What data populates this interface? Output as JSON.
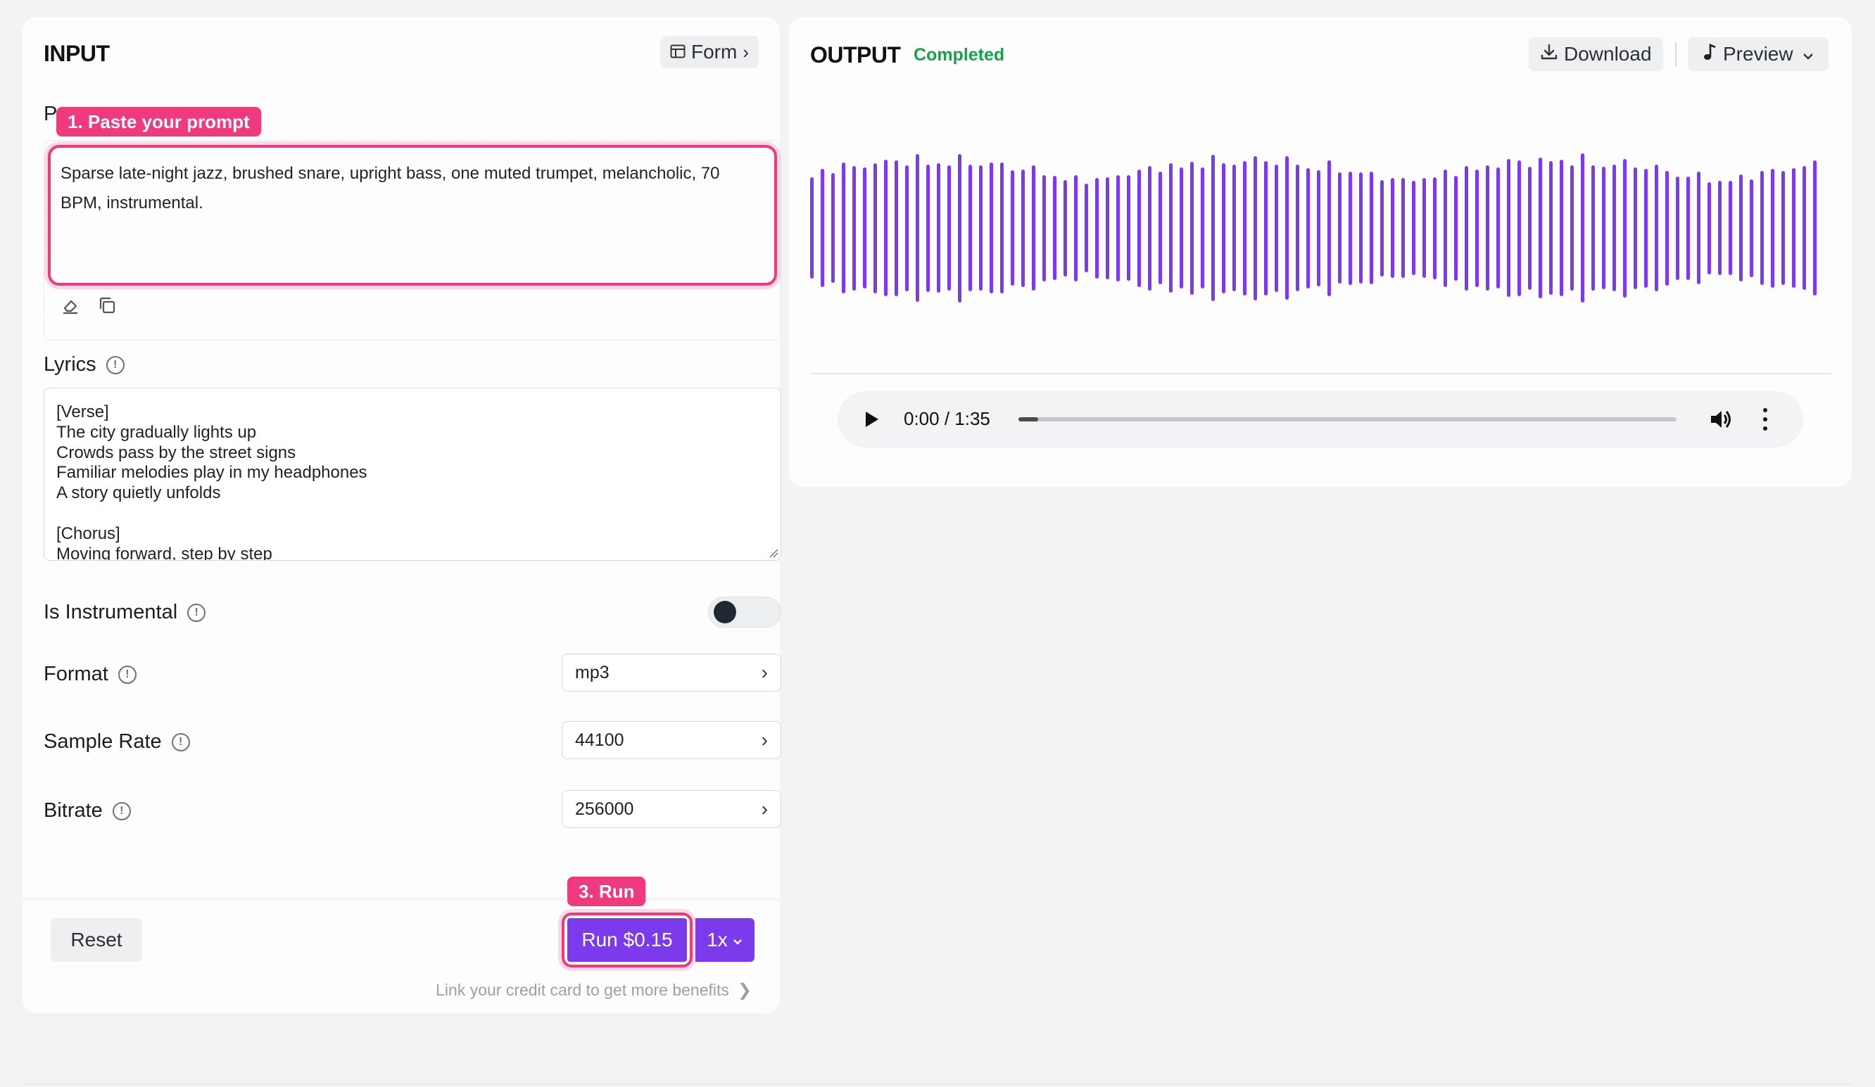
{
  "input": {
    "title": "INPUT",
    "form_label": "Form",
    "prompt_label": "P",
    "prompt_value": "Sparse late-night jazz, brushed snare, upright bass, one muted trumpet, melancholic, 70 BPM, instrumental.",
    "lyrics_label": "Lyrics",
    "lyrics_value": "[Verse]\nThe city gradually lights up\nCrowds pass by the street signs\nFamiliar melodies play in my headphones\nA story quietly unfolds\n\n[Chorus]\nMoving forward, step by step",
    "instrumental_label": "Is Instrumental",
    "instrumental_on": false,
    "format_label": "Format",
    "format_value": "mp3",
    "sample_rate_label": "Sample Rate",
    "sample_rate_value": "44100",
    "bitrate_label": "Bitrate",
    "bitrate_value": "256000",
    "reset_label": "Reset",
    "run_label": "Run $0.15",
    "multiplier_label": "1x",
    "credit_link": "Link your credit card to get more benefits"
  },
  "callouts": {
    "step1": "1. Paste your prompt",
    "step3": "3. Run"
  },
  "output": {
    "title": "OUTPUT",
    "status": "Completed",
    "download_label": "Download",
    "preview_label": "Preview",
    "audio_time": "0:00 / 1:35",
    "progress": 0.03
  },
  "colors": {
    "accent": "#7c3aed",
    "callout": "#f03a7e",
    "status": "#16a34a"
  },
  "icons": [
    "form-table-icon",
    "eraser-icon",
    "copy-icon",
    "info-icon",
    "download-icon",
    "music-note-icon",
    "chevron-down-icon",
    "play-icon",
    "volume-icon",
    "more-vertical-icon"
  ]
}
